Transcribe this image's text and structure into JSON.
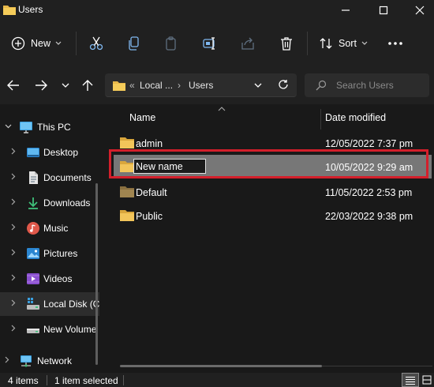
{
  "window": {
    "title": "Users",
    "icons": {
      "folder": "folder-icon",
      "minimize": "minimize-icon",
      "maximize": "maximize-icon",
      "close": "close-icon"
    }
  },
  "toolbar": {
    "new_label": "New",
    "sort_label": "Sort",
    "icons": [
      "new-plus-icon",
      "cut-icon",
      "copy-icon",
      "paste-icon",
      "rename-icon",
      "share-icon",
      "delete-icon",
      "sort-icon",
      "more-icon"
    ]
  },
  "address": {
    "prefix": "«",
    "segment1": "Local ...",
    "separator": "›",
    "segment2": "Users"
  },
  "search": {
    "placeholder": "Search Users"
  },
  "nav": {
    "items": [
      {
        "label": "This PC",
        "icon": "monitor-icon"
      },
      {
        "label": "Desktop",
        "icon": "desktop-icon"
      },
      {
        "label": "Documents",
        "icon": "documents-icon"
      },
      {
        "label": "Downloads",
        "icon": "download-icon"
      },
      {
        "label": "Music",
        "icon": "music-icon"
      },
      {
        "label": "Pictures",
        "icon": "pictures-icon"
      },
      {
        "label": "Videos",
        "icon": "videos-icon"
      },
      {
        "label": "Local Disk (C:)",
        "icon": "local-disk-icon"
      },
      {
        "label": "New Volume (D:)",
        "icon": "drive-icon"
      },
      {
        "label": "Network",
        "icon": "network-icon"
      }
    ]
  },
  "columns": {
    "name": "Name",
    "date": "Date modified"
  },
  "files": [
    {
      "name": "admin",
      "date": "12/05/2022 7:37 pm"
    },
    {
      "name": "",
      "date": "10/05/2022 9:29 am",
      "rename_value": "New name"
    },
    {
      "name": "Default",
      "date": "11/05/2022 2:53 pm"
    },
    {
      "name": "Public",
      "date": "22/03/2022 9:38 pm"
    }
  ],
  "status": {
    "count": "4 items",
    "selected": "1 item selected"
  },
  "colors": {
    "accent_highlight": "#d41f2b",
    "folder": "#e8b84a",
    "selected_row": "#777777"
  }
}
